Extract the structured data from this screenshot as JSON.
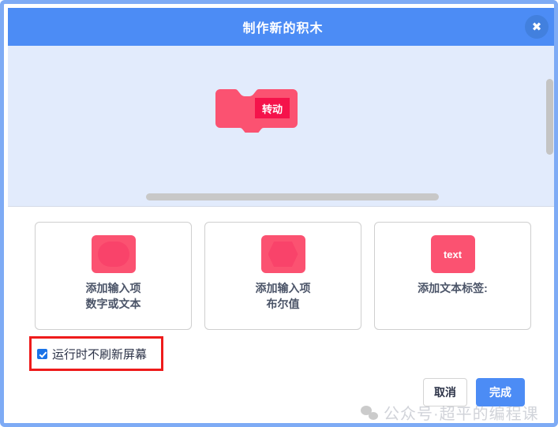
{
  "header": {
    "title": "制作新的积木",
    "close_label": "✖",
    "close_icon": "close-icon"
  },
  "workspace": {
    "block": {
      "label": "转动",
      "shape": "define-hat-block",
      "color": "#fb5271",
      "label_background": "#f5134b"
    },
    "background": "#e2ebfc",
    "scrollbars": {
      "vertical": "vertical-scrollbar",
      "horizontal": "horizontal-scrollbar"
    }
  },
  "options": {
    "cards": [
      {
        "icon": "oval-input-icon",
        "icon_text": "",
        "label": "添加输入项",
        "sublabel": "数字或文本"
      },
      {
        "icon": "hexagon-boolean-icon",
        "icon_text": "",
        "label": "添加输入项",
        "sublabel": "布尔值"
      },
      {
        "icon": "text-label-icon",
        "icon_text": "text",
        "label": "添加文本标签:",
        "sublabel": ""
      }
    ]
  },
  "checkbox": {
    "label": "运行时不刷新屏幕",
    "checked": true,
    "highlight_color": "#ee1b1b"
  },
  "footer": {
    "cancel_label": "取消",
    "confirm_label": "完成"
  },
  "watermark": {
    "icon": "wechat-icon",
    "text": "公众号·超平的编程课"
  },
  "colors": {
    "header_blue": "#4c8cf5",
    "block_pink": "#fb5271",
    "workspace_blue": "#e2ebfc",
    "accent_red": "#ee1b1b"
  }
}
